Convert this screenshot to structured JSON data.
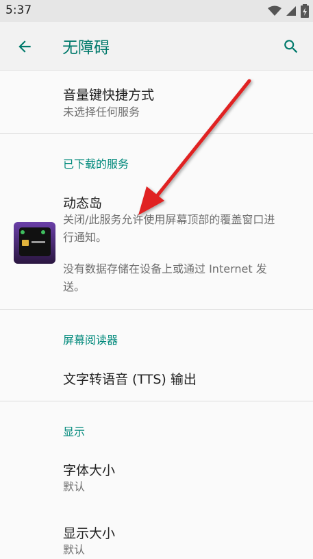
{
  "status_bar": {
    "time": "5:37",
    "icons": [
      "wifi-icon",
      "signal-icon",
      "battery-charging-icon"
    ]
  },
  "app_bar": {
    "title": "无障碍",
    "back_icon": "arrow-back-icon",
    "search_icon": "search-icon",
    "accent_color": "#00796b"
  },
  "volume_shortcut": {
    "title": "音量键快捷方式",
    "summary": "未选择任何服务"
  },
  "downloaded_services": {
    "header": "已下载的服务",
    "item": {
      "title": "动态岛",
      "summary_line1": "关闭/此服务允许使用屏幕顶部的覆盖窗口进",
      "summary_line2": "行通知。",
      "note_line1": "没有数据存储在设备上或通过 Internet 发",
      "note_line2": "送。"
    }
  },
  "screen_readers": {
    "header": "屏幕阅读器",
    "item": {
      "title": "文字转语音 (TTS) 输出"
    }
  },
  "display": {
    "header": "显示",
    "items": [
      {
        "title": "字体大小",
        "summary": "默认"
      },
      {
        "title": "显示大小",
        "summary": "默认"
      }
    ]
  },
  "colors": {
    "section_header": "#00897b",
    "annotation_arrow": "#e02020"
  }
}
